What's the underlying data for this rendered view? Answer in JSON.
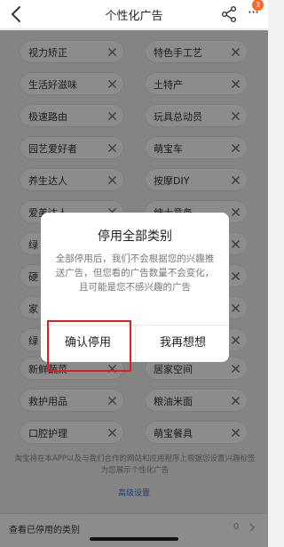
{
  "nav": {
    "title": "个性化广告",
    "badge": "3"
  },
  "chips": [
    {
      "label": "视力矫正"
    },
    {
      "label": "特色手工艺"
    },
    {
      "label": "生活好滋味"
    },
    {
      "label": "土特产"
    },
    {
      "label": "极速路由"
    },
    {
      "label": "玩具总动员"
    },
    {
      "label": "园艺爱好者"
    },
    {
      "label": "萌宝车"
    },
    {
      "label": "养生达人"
    },
    {
      "label": "按摩DIY"
    },
    {
      "label": "爱美达人"
    },
    {
      "label": "绅士意务"
    },
    {
      "label": "绿"
    },
    {
      "label": ""
    },
    {
      "label": "硬"
    },
    {
      "label": ""
    },
    {
      "label": "家"
    },
    {
      "label": ""
    },
    {
      "label": "绿"
    },
    {
      "label": ""
    },
    {
      "label": "新鲜蔬菜"
    },
    {
      "label": "居家空间"
    },
    {
      "label": "救护用品"
    },
    {
      "label": "粮油米面"
    },
    {
      "label": "口腔护理"
    },
    {
      "label": "萌宝餐具"
    }
  ],
  "footer": {
    "note": "淘宝将在本APP以及与我们合作的网站和应用程序上根据您设置兴趣标签为您展示个性化广告",
    "advanced_link": "高级设置"
  },
  "stopped": {
    "label": "查看已停用的类别",
    "count": "0"
  },
  "dialog": {
    "title": "停用全部类别",
    "message": "全部停用后，我们不会根据您的兴趣推送广告，但您看的广告数量不会变化，且可能是您不感兴趣的广告",
    "confirm_label": "确认停用",
    "cancel_label": "我再想想"
  },
  "colors": {
    "highlight": "#e02020",
    "badge": "#f56a2a",
    "link": "#3b6fd6"
  }
}
